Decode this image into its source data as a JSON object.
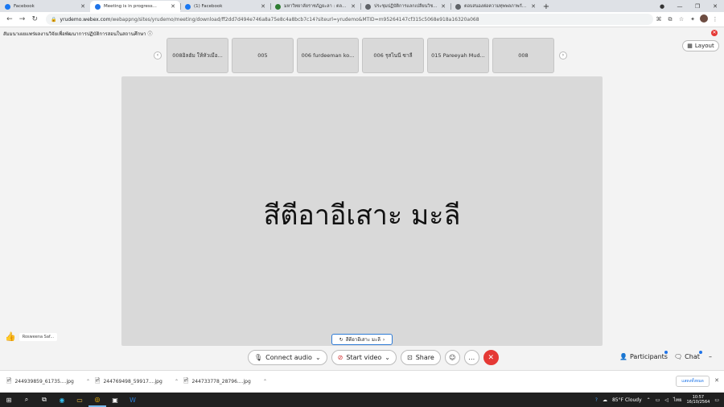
{
  "browser": {
    "tabs": [
      {
        "title": "Facebook",
        "fav_color": "#1877f2"
      },
      {
        "title": "Meeting is in progress...",
        "fav_color": "#1e73e8",
        "active": true
      },
      {
        "title": "(1) Facebook",
        "fav_color": "#1877f2"
      },
      {
        "title": "มหาวิทยาลัยราชภัฏยะลา : ตลอดชีวิต",
        "fav_color": "#2e7d32"
      },
      {
        "title": "ประชุมปฏิบัติการแลกเปลี่ยนวิชาการ โคร...",
        "fav_color": "#5f6368"
      },
      {
        "title": "ตอบสนองต่อความทุพพลภาพกับโลกแ...",
        "fav_color": "#5f6368"
      }
    ],
    "new_tab_label": "+",
    "url_host": "yrudemo.webex.com",
    "url_path": "/webappng/sites/yrudemo/meeting/download/ff2dd7d494e746a8a75e8c4a8bcb7c14?siteurl=yrudemo&MTID=m95264147cf315c5068e918a16320a068"
  },
  "meeting": {
    "title": "สัมมนาเผยแพร่ผลงานวิจัยเพื่อพัฒนาการปฏิบัติการสอนในสถานศึกษา ⓘ",
    "layout_label": "Layout",
    "thumbnails": [
      "008อิลฮัม ให้หัวเมือ...",
      "005",
      "006 furdeeman ko...",
      "006 รุสไนนี ซาลี",
      "015 Pareeyah Mud...",
      "008"
    ],
    "active_speaker": "สีตีอาอีเสาะ มะลี",
    "name_tag": "สีตีอาอีเสาะ มะลี",
    "reaction_user": "Rosweena Saf...",
    "controls": {
      "audio": "Connect audio",
      "video": "Start video",
      "share": "Share"
    },
    "participants_label": "Participants",
    "chat_label": "Chat"
  },
  "downloads": {
    "files": [
      "244939859_61735....jpg",
      "244769498_59917....jpg",
      "244733778_28796....jpg"
    ],
    "show_all": "แสดงทั้งหมด"
  },
  "taskbar": {
    "weather": "85°F  Cloudy",
    "lang": "ไทย",
    "time": "10:57",
    "date": "16/10/2564"
  },
  "colors": {
    "accent": "#1e73e8",
    "end_call": "#e53935",
    "stage": "#d9d9d9"
  }
}
